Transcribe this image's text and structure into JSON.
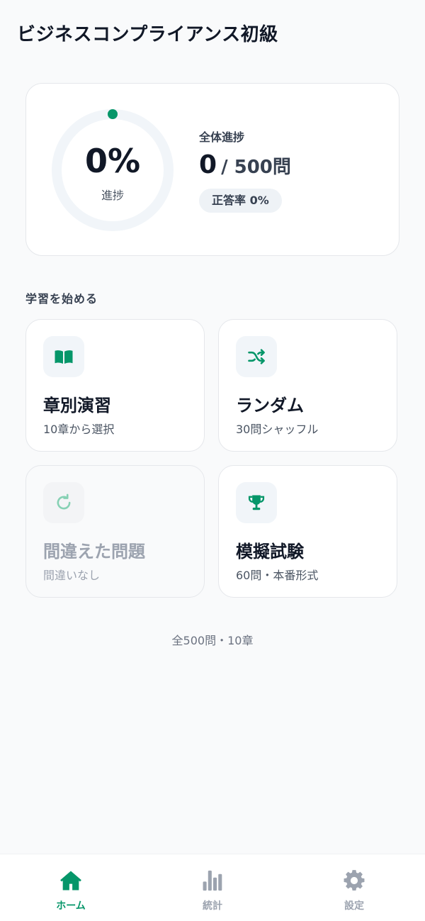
{
  "header": {
    "title": "ビジネスコンプライアンス初級"
  },
  "progress": {
    "percent_text": "0%",
    "percent_value": 0,
    "ring_label": "進捗",
    "overall_label": "全体進捗",
    "done_count": "0",
    "total_text": "/ 500問",
    "accuracy_text": "正答率 0%"
  },
  "section": {
    "label": "学習を始める"
  },
  "modes": [
    {
      "title": "章別演習",
      "subtitle": "10章から選択",
      "icon": "book-icon",
      "enabled": true
    },
    {
      "title": "ランダム",
      "subtitle": "30問シャッフル",
      "icon": "shuffle-icon",
      "enabled": true
    },
    {
      "title": "間違えた問題",
      "subtitle": "間違いなし",
      "icon": "retry-icon",
      "enabled": false
    },
    {
      "title": "模擬試験",
      "subtitle": "60問・本番形式",
      "icon": "trophy-icon",
      "enabled": true
    }
  ],
  "footer": {
    "summary": "全500問・10章"
  },
  "tabs": [
    {
      "label": "ホーム",
      "icon": "home-icon",
      "active": true
    },
    {
      "label": "統計",
      "icon": "bar-chart-icon",
      "active": false
    },
    {
      "label": "設定",
      "icon": "gear-icon",
      "active": false
    }
  ],
  "colors": {
    "accent": "#059669",
    "ring_track": "#f1f5f9",
    "text_primary": "#111827",
    "text_muted": "#9ca3af"
  }
}
